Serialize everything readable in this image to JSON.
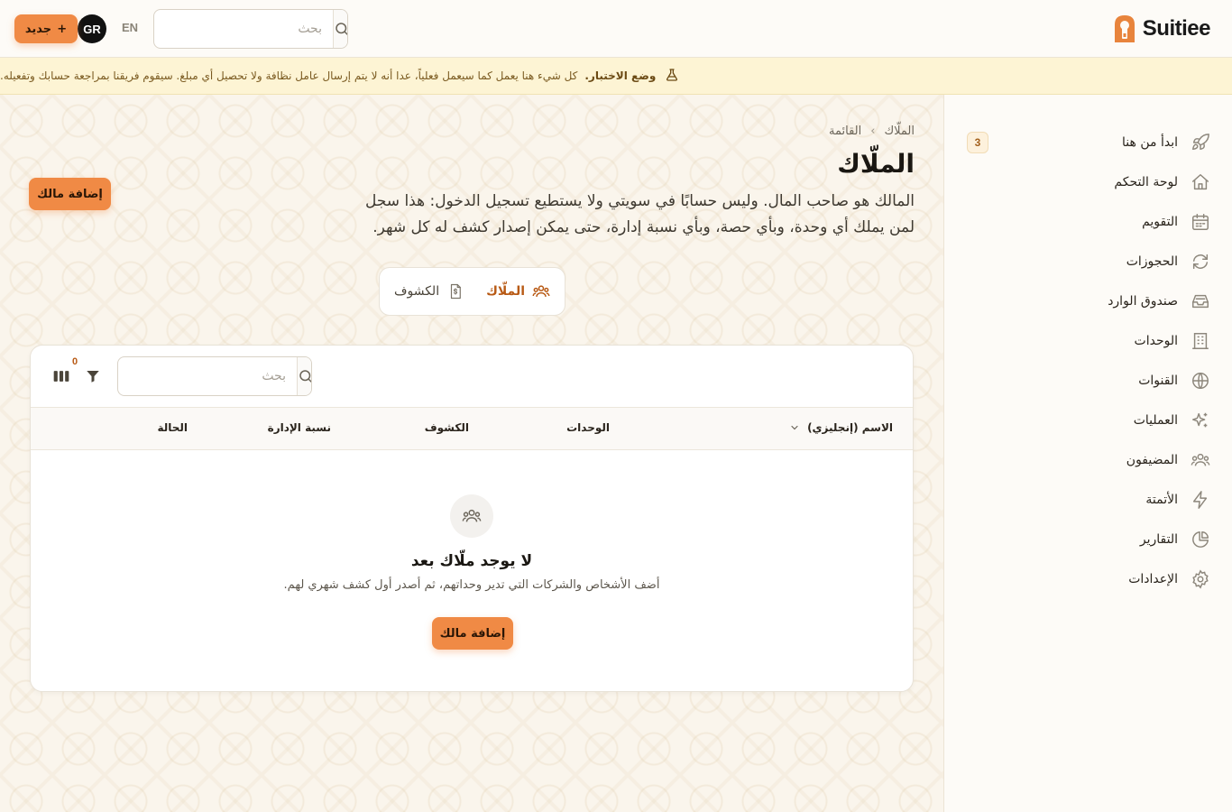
{
  "header": {
    "brand_name": "Suitiee",
    "new_button_label": "جديد",
    "new_button_plus": "+",
    "avatar_initials": "GR",
    "language_toggle": "EN",
    "search_placeholder": "بحث"
  },
  "banner": {
    "title": "وضع الاختبار.",
    "text": "كل شيء هنا يعمل كما سيعمل فعلياً، عدا أنه لا يتم إرسال عامل نظافة ولا تحصيل أي مبلغ. سيقوم فريقنا بمراجعة حسابك وتفعيله.",
    "icon": "flask-icon"
  },
  "sidebar": {
    "items": [
      {
        "label": "ابدأ من هنا",
        "icon": "rocket-icon",
        "badge": "3"
      },
      {
        "label": "لوحة التحكم",
        "icon": "home-icon"
      },
      {
        "label": "التقويم",
        "icon": "calendar-icon"
      },
      {
        "label": "الحجوزات",
        "icon": "refresh-icon"
      },
      {
        "label": "صندوق الوارد",
        "icon": "inbox-icon"
      },
      {
        "label": "الوحدات",
        "icon": "building-icon"
      },
      {
        "label": "القنوات",
        "icon": "globe-icon"
      },
      {
        "label": "العمليات",
        "icon": "sparkles-icon"
      },
      {
        "label": "المضيفون",
        "icon": "users-icon"
      },
      {
        "label": "الأتمتة",
        "icon": "bolt-icon"
      },
      {
        "label": "التقارير",
        "icon": "pie-chart-icon"
      },
      {
        "label": "الإعدادات",
        "icon": "gear-icon"
      }
    ]
  },
  "page": {
    "breadcrumb": [
      "الملّاك",
      "القائمة"
    ],
    "breadcrumb_separator": "›",
    "title": "الملّاك",
    "description": "المالك هو صاحب المال. وليس حسابًا في سويتي ولا يستطيع تسجيل الدخول: هذا سجل لمن يملك أي وحدة، وبأي حصة، وبأي نسبة إدارة، حتى يمكن إصدار كشف له كل شهر.",
    "add_owner_label": "إضافة مالك"
  },
  "tabs": [
    {
      "label": "الملّاك",
      "icon": "users-icon",
      "active": true
    },
    {
      "label": "الكشوف",
      "icon": "statement-icon",
      "active": false
    }
  ],
  "table": {
    "search_placeholder": "بحث",
    "filter_count": "0",
    "columns": [
      "الاسم (إنجليزي)",
      "الوحدات",
      "الكشوف",
      "نسبة الإدارة",
      "الحالة"
    ],
    "rows": []
  },
  "empty_state": {
    "title": "لا يوجد ملّاك بعد",
    "description": "أضف الأشخاص والشركات التي تدير وحداتهم، ثم أصدر أول كشف شهري لهم.",
    "button_label": "إضافة مالك"
  },
  "colors": {
    "accent": "#f08a45",
    "accent_text": "#b85a15",
    "banner_bg": "#fdf4d4",
    "background": "#faf5ec"
  }
}
